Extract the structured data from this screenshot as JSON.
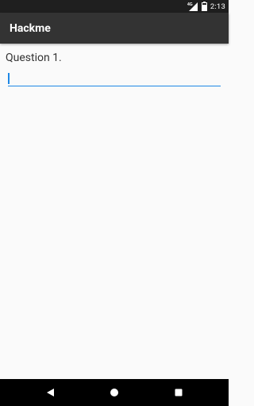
{
  "status_bar": {
    "network_label": "4G",
    "time": "2:13"
  },
  "app_bar": {
    "title": "Hackme"
  },
  "content": {
    "question_label": "Question 1.",
    "answer_value": "",
    "answer_placeholder": ""
  },
  "icons": {
    "signal": "signal-icon",
    "battery": "battery-icon",
    "back": "back-icon",
    "home": "home-icon",
    "recents": "recents-icon"
  },
  "colors": {
    "status_bar": "#1f1f1f",
    "app_bar": "#333333",
    "background": "#fafafa",
    "accent": "#1e88e5",
    "nav_bar": "#000000"
  }
}
